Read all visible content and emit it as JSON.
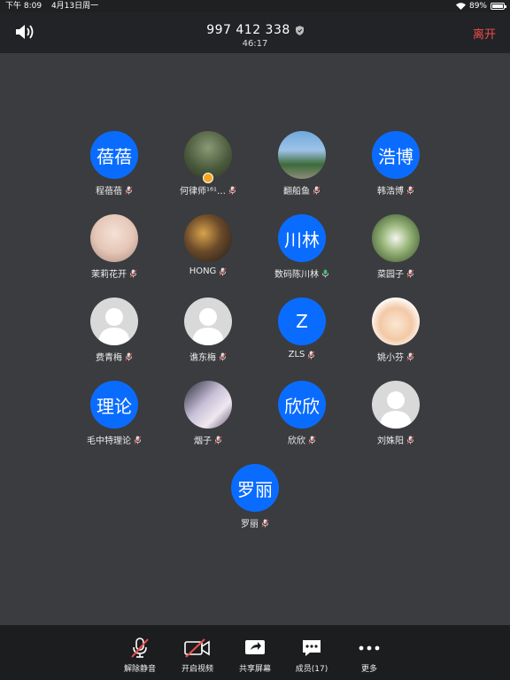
{
  "status_bar": {
    "time": "下午 8:09",
    "date": "4月13日周一",
    "battery": "89%"
  },
  "header": {
    "meeting_id": "997 412 338",
    "duration": "46:17",
    "leave_label": "离开"
  },
  "participants": [
    {
      "name": "程蓓蓓",
      "avatar_text": "蓓蓓",
      "avatar_type": "text"
    },
    {
      "name": "何律师¹⁶¹…",
      "avatar_text": "",
      "avatar_type": "photo"
    },
    {
      "name": "翻船鱼",
      "avatar_text": "",
      "avatar_type": "photo"
    },
    {
      "name": "韩浩博",
      "avatar_text": "浩博",
      "avatar_type": "text"
    },
    {
      "name": "茉莉花开",
      "avatar_text": "",
      "avatar_type": "photo"
    },
    {
      "name": "HONG",
      "avatar_text": "",
      "avatar_type": "photo"
    },
    {
      "name": "数码陈川林",
      "avatar_text": "川林",
      "avatar_type": "text"
    },
    {
      "name": "菜园子",
      "avatar_text": "",
      "avatar_type": "photo"
    },
    {
      "name": "费青梅",
      "avatar_text": "",
      "avatar_type": "default"
    },
    {
      "name": "谯东梅",
      "avatar_text": "",
      "avatar_type": "default"
    },
    {
      "name": "ZLS",
      "avatar_text": "Z",
      "avatar_type": "text"
    },
    {
      "name": "姚小芬",
      "avatar_text": "",
      "avatar_type": "photo"
    },
    {
      "name": "毛中特理论",
      "avatar_text": "理论",
      "avatar_type": "text"
    },
    {
      "name": "烟子",
      "avatar_text": "",
      "avatar_type": "photo"
    },
    {
      "name": "欣欣",
      "avatar_text": "欣欣",
      "avatar_type": "text"
    },
    {
      "name": "刘姝阳",
      "avatar_text": "",
      "avatar_type": "default"
    },
    {
      "name": "罗丽",
      "avatar_text": "罗丽",
      "avatar_type": "text"
    }
  ],
  "toolbar": {
    "unmute_label": "解除静音",
    "video_label": "开启视频",
    "share_label": "共享屏幕",
    "members_label": "成员(17)",
    "more_label": "更多"
  },
  "colors": {
    "accent_blue": "#0a6cff",
    "leave_red": "#ef4d4d",
    "background": "#3b3c3f"
  }
}
